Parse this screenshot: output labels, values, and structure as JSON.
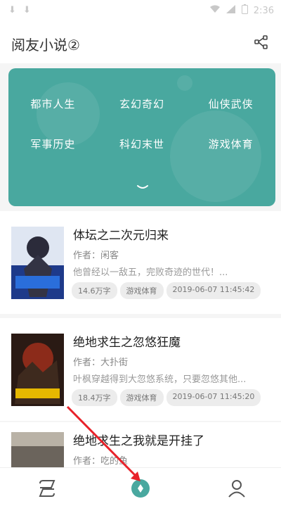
{
  "status_bar": {
    "time": "2:36"
  },
  "header": {
    "title": "阅友小说②"
  },
  "genres": [
    "都市人生",
    "玄幻奇幻",
    "仙侠武侠",
    "军事历史",
    "科幻末世",
    "游戏体育"
  ],
  "books": [
    {
      "title": "体坛之二次元归来",
      "author": "作者：闲客",
      "desc": "他曾经以一敌五，完败奇迹的世代！...",
      "words": "14.6万字",
      "genre": "游戏体育",
      "updated": "2019-06-07 11:45:42"
    },
    {
      "title": "绝地求生之忽悠狂魔",
      "author": "作者：大扑街",
      "desc": "叶枫穿越得到大忽悠系统，只要忽悠其他...",
      "words": "18.4万字",
      "genre": "游戏体育",
      "updated": "2019-06-07 11:45:20"
    },
    {
      "title": "绝地求生之我就是开挂了",
      "author": "作者：吃的鱼",
      "desc": "",
      "words": "",
      "genre": "",
      "updated": ""
    }
  ],
  "colors": {
    "accent": "#49a89f",
    "arrow": "#e8222a"
  },
  "icons": {
    "share": "share-icon",
    "bookshelf": "bookshelf-icon",
    "discover": "compass-icon",
    "profile": "profile-icon"
  }
}
